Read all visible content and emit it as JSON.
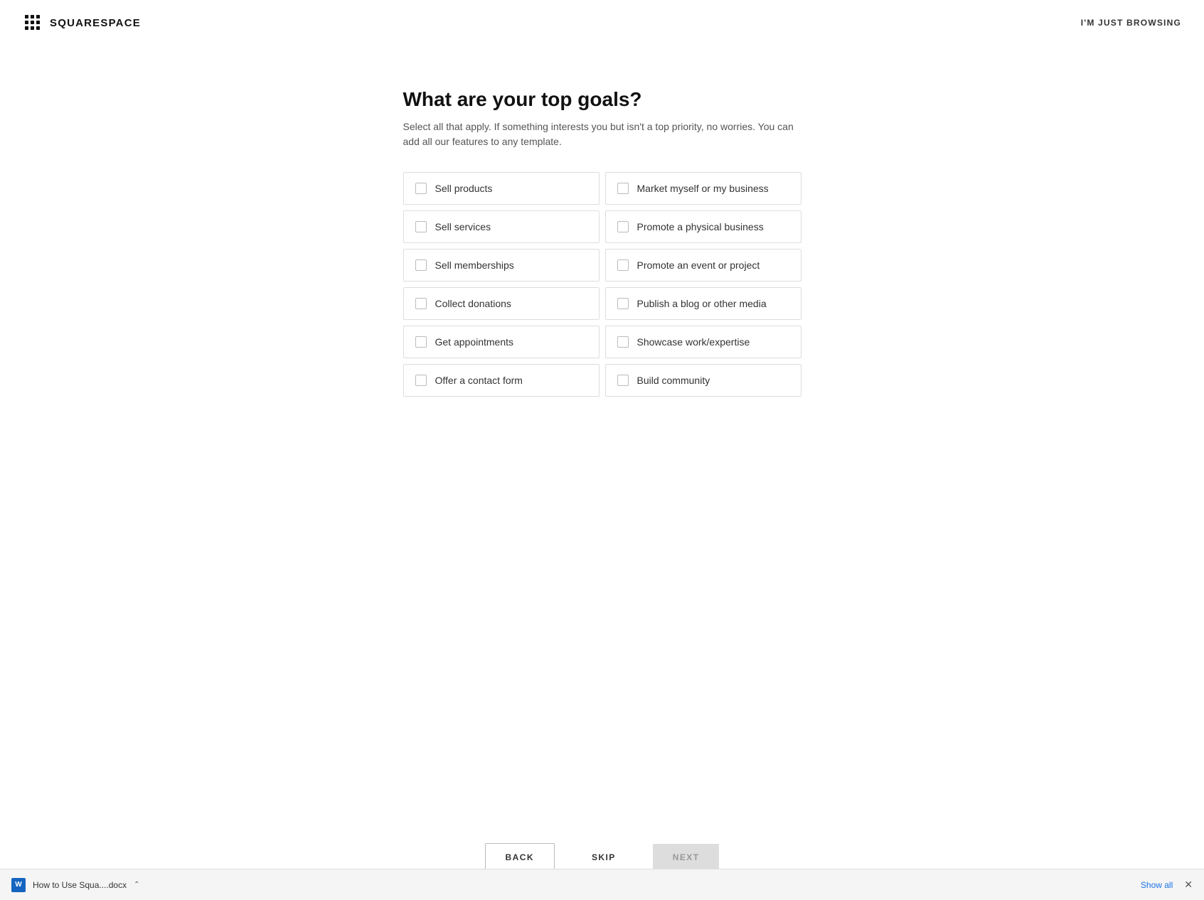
{
  "header": {
    "logo_text": "SQUARESPACE",
    "just_browsing": "I'M JUST BROWSING"
  },
  "page": {
    "title": "What are your top goals?",
    "subtitle_plain": "Select all that apply. If something interests you but isn't a top priority, no worries. You can add all our features to any template.",
    "subtitle_parts": [
      {
        "text": "Select all that apply. If something interests you ",
        "type": "normal"
      },
      {
        "text": "but",
        "type": "normal"
      },
      {
        "text": " isn't a top priority",
        "type": "normal"
      },
      {
        "text": ", no worries. You",
        "type": "normal"
      },
      {
        "text": " can add all our features to any template.",
        "type": "normal"
      }
    ]
  },
  "goals": {
    "left_column": [
      {
        "id": "sell-products",
        "label": "Sell products"
      },
      {
        "id": "sell-services",
        "label": "Sell services"
      },
      {
        "id": "sell-memberships",
        "label": "Sell memberships"
      },
      {
        "id": "collect-donations",
        "label": "Collect donations"
      },
      {
        "id": "get-appointments",
        "label": "Get appointments"
      },
      {
        "id": "offer-contact-form",
        "label": "Offer a contact form"
      }
    ],
    "right_column": [
      {
        "id": "market-myself",
        "label": "Market myself or my business"
      },
      {
        "id": "promote-physical",
        "label": "Promote a physical business"
      },
      {
        "id": "promote-event",
        "label": "Promote an event or project"
      },
      {
        "id": "publish-blog",
        "label": "Publish a blog or other media"
      },
      {
        "id": "showcase-work",
        "label": "Showcase work/expertise"
      },
      {
        "id": "build-community",
        "label": "Build community"
      }
    ]
  },
  "nav": {
    "back": "BACK",
    "skip": "SKIP",
    "next": "NEXT"
  },
  "download_bar": {
    "filename": "How to Use Squa....docx",
    "show_all": "Show all",
    "close": "✕"
  }
}
